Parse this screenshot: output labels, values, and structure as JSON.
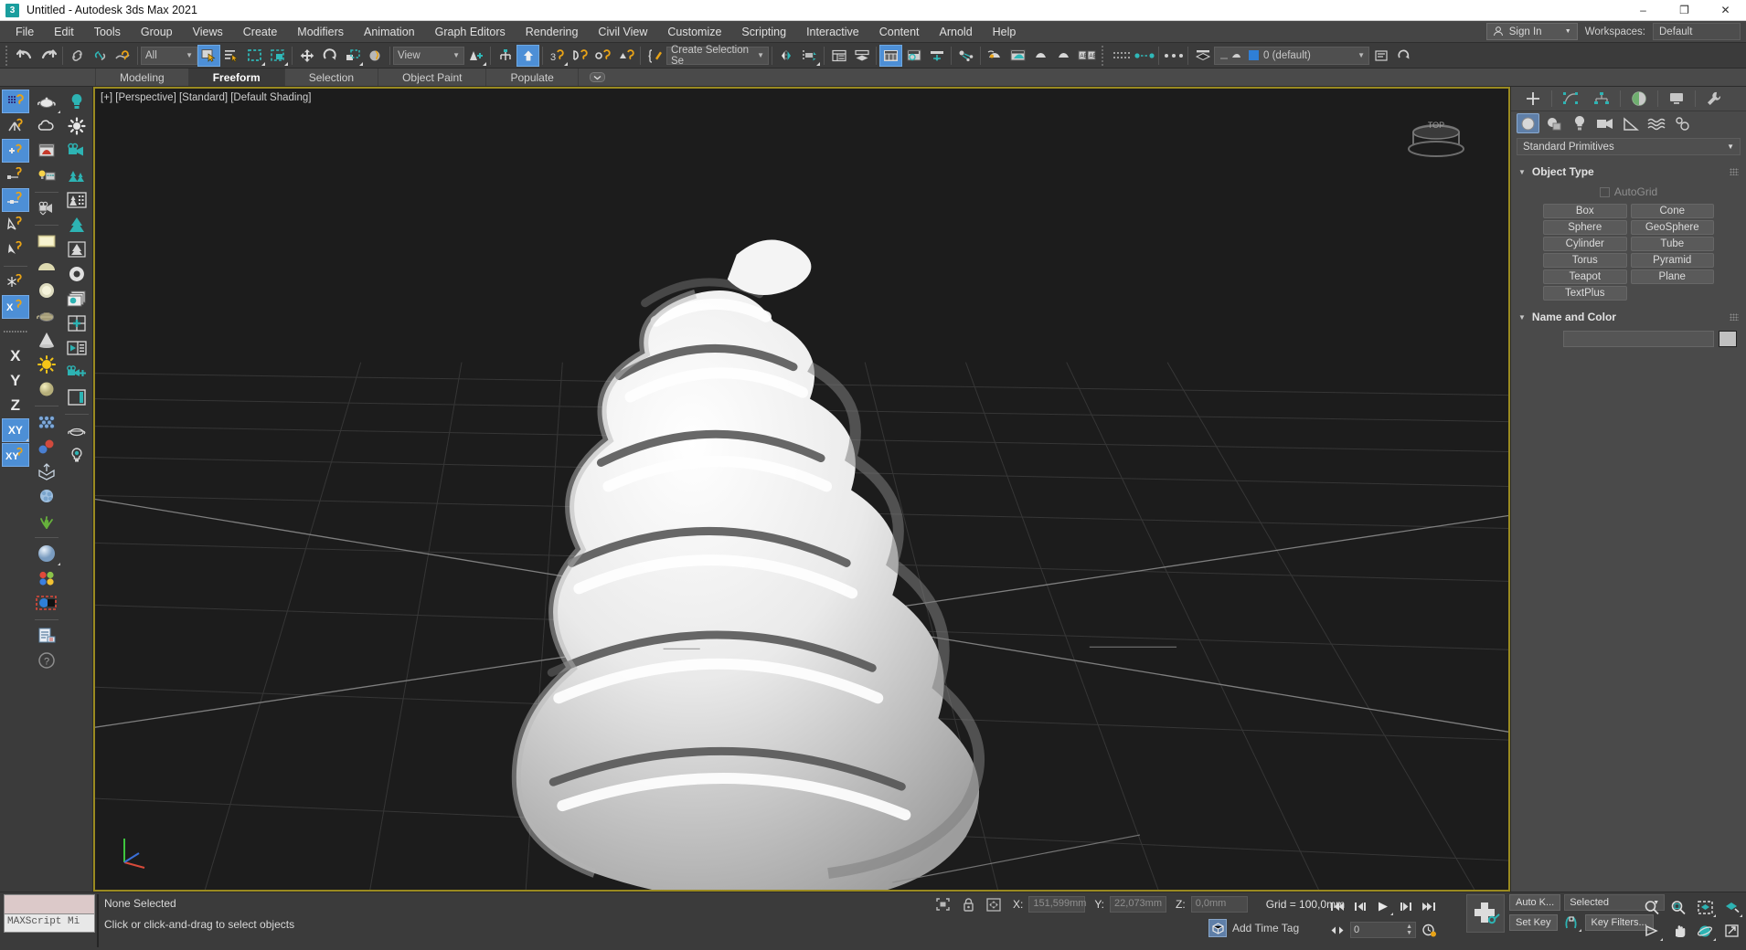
{
  "window": {
    "title": "Untitled - Autodesk 3ds Max 2021",
    "app_icon": "3",
    "minimize": "–",
    "maximize": "❐",
    "close": "✕"
  },
  "menu": {
    "items": [
      "File",
      "Edit",
      "Tools",
      "Group",
      "Views",
      "Create",
      "Modifiers",
      "Animation",
      "Graph Editors",
      "Rendering",
      "Civil View",
      "Customize",
      "Scripting",
      "Interactive",
      "Content",
      "Arnold",
      "Help"
    ],
    "sign_in": "Sign In",
    "workspaces_label": "Workspaces:",
    "workspace_value": "Default"
  },
  "toolbar": {
    "selection_filter": "All",
    "reference_coord": "View",
    "named_selection_sets": "Create Selection Se",
    "layer_value": "0 (default)",
    "icons": [
      "undo-icon",
      "redo-icon",
      "select-link-icon",
      "unlink-icon",
      "bind-space-warp-icon",
      "select-object-icon",
      "select-by-name-icon",
      "rectangular-select-region-icon",
      "window-crossing-icon",
      "select-and-move-icon",
      "select-and-rotate-icon",
      "select-and-scale-icon",
      "placement-icon",
      "use-center-flyout-icon",
      "select-and-manipulate-icon",
      "snaps-toggle-icon",
      "angle-snap-icon",
      "percent-snap-icon",
      "spinner-snap-icon",
      "edit-named-selection-icon",
      "mirror-icon",
      "align-icon",
      "layer-explorer-icon",
      "scene-explorer-icon",
      "ribbon-toggle-icon",
      "curve-editor-icon",
      "schematic-view-icon",
      "material-editor-icon",
      "render-setup-icon",
      "render-frame-window-icon",
      "render-production-icon",
      "render-iterative-icon",
      "project-folder-icon"
    ]
  },
  "ribbon": {
    "tabs": [
      "Modeling",
      "Freeform",
      "Selection",
      "Object Paint",
      "Populate"
    ],
    "selected_tab": "Freeform",
    "minimize_icon": "ribbon-minimize-icon"
  },
  "viewport": {
    "label": "[+] [Perspective] [Standard] [Default Shading]",
    "viewcube_name": "view-cube",
    "axis_tripod_name": "axis-tripod",
    "background_color": "#1c1c1c",
    "grid_color": "#4a4a4a",
    "object_description": "whipped-cream-swirl-mesh"
  },
  "left_toolbar": {
    "column1": [
      "snaps-toggle-icon",
      "angle-snap-toggle-icon",
      "percent-snap-toggle-icon",
      "spinner-snap-toggle-icon",
      "edged-faces-icon",
      "select-similar-icon",
      "select-invert-icon",
      "freeze-icon",
      "axis-constraint-x-icon",
      "axis-x-icon",
      "axis-y-icon",
      "axis-z-icon",
      "axis-xy-icon",
      "axis-xy-snap-icon"
    ],
    "column2": [
      "teapot-icon",
      "cloud-icon",
      "render-preview-icon",
      "light-setup-icon",
      "camera-icon",
      "plane-light-icon",
      "dome-light-icon",
      "sphere-light-icon",
      "teapot-wire-icon",
      "cone-icon",
      "sun-icon",
      "sphere-gradient-icon",
      "particle-array-icon",
      "compound-object-icon",
      "dynamics-icon",
      "cloth-icon",
      "grass-icon",
      "sphere-mat-icon",
      "color-swatches-icon",
      "select-highlight-icon",
      "report-icon",
      "help-icon"
    ],
    "column3": [
      "light-bulb-icon",
      "sunlight-icon",
      "camera-green-icon",
      "foliage-icon",
      "building-icon",
      "tree-icon",
      "tree-flat-icon",
      "torus-ring-icon",
      "layers-icon",
      "viewport-grid-icon",
      "play-panel-icon",
      "camera-add-icon",
      "panel-icon",
      "teapot-outline-icon",
      "bulb-small-icon"
    ]
  },
  "command_panel": {
    "tabs": [
      "create-tab",
      "modify-tab",
      "hierarchy-tab",
      "motion-tab",
      "display-tab",
      "utilities-tab"
    ],
    "categories": [
      "geometry-icon",
      "shapes-icon",
      "lights-icon",
      "cameras-icon",
      "helpers-icon",
      "space-warps-icon",
      "systems-icon"
    ],
    "category_dropdown": "Standard Primitives",
    "object_type": {
      "title": "Object Type",
      "autogrid_label": "AutoGrid",
      "autogrid_checked": false,
      "buttons": [
        "Box",
        "Cone",
        "Sphere",
        "GeoSphere",
        "Cylinder",
        "Tube",
        "Torus",
        "Pyramid",
        "Teapot",
        "Plane",
        "TextPlus"
      ]
    },
    "name_and_color": {
      "title": "Name and Color",
      "name_value": "",
      "color_swatch": "#c0c0c0"
    }
  },
  "status_bar": {
    "maxscript_placeholder": "MAXScript Mi",
    "selection_status": "None Selected",
    "prompt": "Click or click-and-drag to select objects",
    "coordinates": {
      "x_label": "X:",
      "x_value": "151,599mm",
      "y_label": "Y:",
      "y_value": "22,073mm",
      "z_label": "Z:",
      "z_value": "0,0mm"
    },
    "grid_text": "Grid = 100,0mm",
    "add_time_tag": "Add Time Tag",
    "selection_lock_icon": "selection-lock-icon",
    "absolute_mode_icon": "absolute-relative-transform-icon",
    "isolate_icon": "isolate-selection-icon"
  },
  "animation": {
    "frame_value": "0",
    "auto_key": "Auto K...",
    "set_key": "Set Key",
    "key_filters": "Key Filters...",
    "key_mode_value": "Selected",
    "transport": [
      "go-to-start-icon",
      "previous-frame-icon",
      "play-icon",
      "next-frame-icon",
      "go-to-end-icon"
    ],
    "time_config_icon": "time-configuration-icon",
    "key_toggle_icon": "key-mode-toggle-icon",
    "set_key_big_icon": "set-keys-icon"
  },
  "navigation": {
    "row1": [
      "zoom-icon",
      "zoom-all-icon",
      "zoom-extents-icon",
      "zoom-region-icon"
    ],
    "row2": [
      "field-of-view-icon",
      "pan-view-icon",
      "orbit-icon",
      "maximize-viewport-icon"
    ]
  },
  "colors": {
    "accent": "#4d8fd6",
    "teal": "#27b5b5",
    "viewport_border": "#9a8a20",
    "panel_bg": "#4a4a4a",
    "toolbar_bg": "#3b3b3b"
  }
}
